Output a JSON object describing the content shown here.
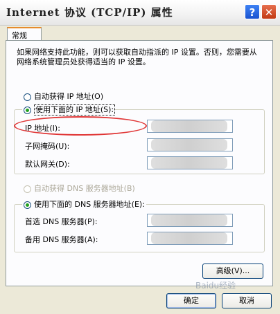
{
  "window": {
    "title": "Internet 协议 (TCP/IP) 属性",
    "help_glyph": "?",
    "close_glyph": "✕"
  },
  "tabs": [
    {
      "label": "常规",
      "selected": true
    }
  ],
  "description": "如果网络支持此功能，则可以获取自动指派的 IP 设置。否则，您需要从网络系统管理员处获得适当的 IP 设置。",
  "ip_mode": {
    "auto_label": "自动获得 IP 地址(O)",
    "manual_label": "使用下面的 IP 地址(S):",
    "selected": "manual"
  },
  "ip_fields": [
    {
      "label": "IP 地址(I):",
      "value": ""
    },
    {
      "label": "子网掩码(U):",
      "value": ""
    },
    {
      "label": "默认网关(D):",
      "value": ""
    }
  ],
  "dns_mode": {
    "auto_label": "自动获得 DNS 服务器地址(B)",
    "manual_label": "使用下面的 DNS 服务器地址(E):",
    "selected": "manual",
    "auto_disabled": true
  },
  "dns_fields": [
    {
      "label": "首选 DNS 服务器(P):",
      "value": ""
    },
    {
      "label": "备用 DNS 服务器(A):",
      "value": ""
    }
  ],
  "buttons": {
    "advanced": "高级(V)...",
    "ok": "确定",
    "cancel": "取消"
  },
  "watermark": "Baidu经验",
  "colors": {
    "highlight_ellipse": "#e03535",
    "radio_dot": "#21a121",
    "tab_accent": "#e68b2c"
  }
}
